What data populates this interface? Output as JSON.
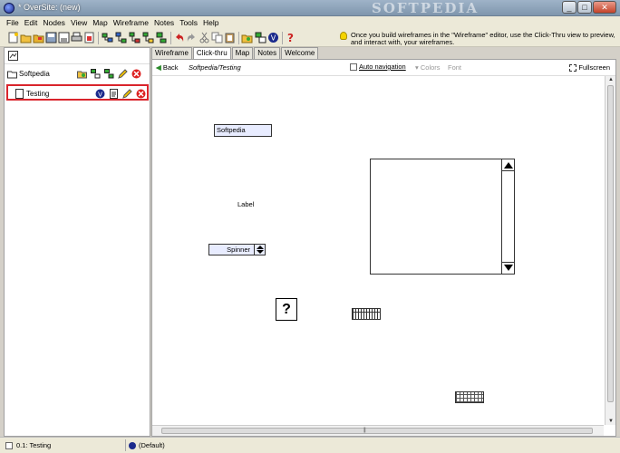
{
  "window": {
    "title": "* OverSite: (new)",
    "watermark": "SOFTPEDIA",
    "controls": [
      "_",
      "□",
      "✕"
    ]
  },
  "menu": [
    "File",
    "Edit",
    "Nodes",
    "View",
    "Map",
    "Wireframe",
    "Notes",
    "Tools",
    "Help"
  ],
  "hint": {
    "text": "Once you build wireframes in the \"Wireframe\" editor, use the Click-Thru view to preview, and interact with, your wireframes."
  },
  "tree": {
    "root_label": "Softpedia",
    "child_label": "Testing"
  },
  "tabs": [
    {
      "label": "Wireframe",
      "active": false
    },
    {
      "label": "Click-thru",
      "active": true
    },
    {
      "label": "Map",
      "active": false
    },
    {
      "label": "Notes",
      "active": false
    },
    {
      "label": "Welcome",
      "active": false
    }
  ],
  "nav": {
    "back_label": "Back",
    "breadcrumb": "Softpedia/Testing",
    "auto_nav_label": "Auto navigation",
    "colors_label": "Colors",
    "font_label": "Font",
    "fullscreen_label": "Fullscreen"
  },
  "widgets": {
    "textfield_value": "Softpedia",
    "label_text": "Label",
    "spinner_value": "Spinner",
    "image_placeholder": "?"
  },
  "status": {
    "node": "0.1: Testing",
    "style": "(Default)"
  },
  "colors": {
    "selection_border": "#d9242c",
    "widget_fill": "#e8ecff"
  }
}
